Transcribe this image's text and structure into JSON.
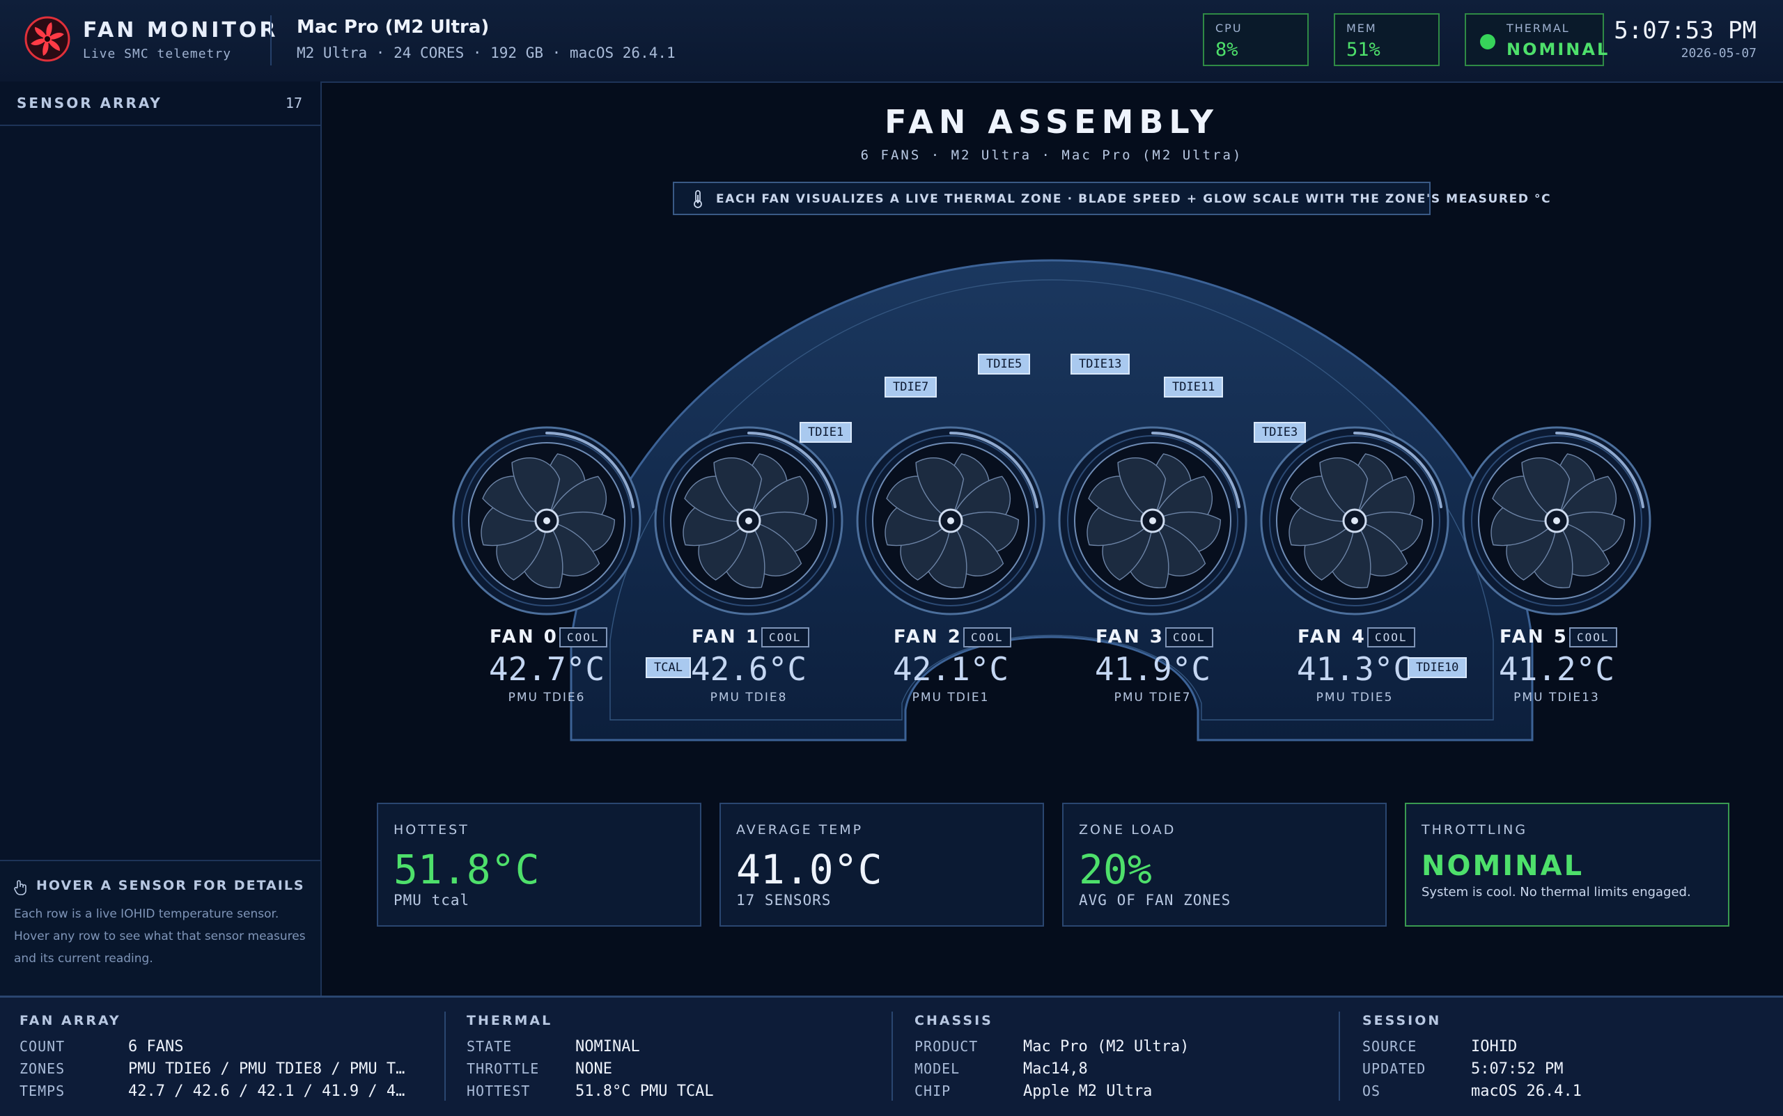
{
  "app": {
    "title": "FAN MONITOR",
    "subtitle": "Live SMC telemetry"
  },
  "machine": {
    "name": "Mac Pro (M2 Ultra)",
    "meta": "M2 Ultra · 24 CORES · 192 GB · macOS 26.4.1"
  },
  "stats": {
    "cpu": {
      "label": "CPU",
      "value": "8%"
    },
    "mem": {
      "label": "MEM",
      "value": "51%"
    },
    "thermal": {
      "label": "THERMAL",
      "value": "NOMINAL"
    }
  },
  "clock": {
    "time": "5:07:53 PM",
    "date": "2026-05-07"
  },
  "sidebar": {
    "title": "SENSOR ARRAY",
    "count": "17",
    "hint_title": "HOVER A SENSOR FOR DETAILS",
    "hint_body": "Each row is a live IOHID temperature sensor. Hover any row to see what that sensor measures and its current reading."
  },
  "main": {
    "title": "FAN ASSEMBLY",
    "subtitle": "6 FANS  ·  M2 Ultra  ·  Mac Pro (M2 Ultra)",
    "banner": "EACH FAN VISUALIZES A LIVE THERMAL ZONE · BLADE SPEED + GLOW SCALE WITH THE ZONE'S MEASURED °C"
  },
  "fans": [
    {
      "name": "FAN 0",
      "badge": "COOL",
      "temp": "42.7°C",
      "zone": "PMU TDIE6"
    },
    {
      "name": "FAN 1",
      "badge": "COOL",
      "temp": "42.6°C",
      "zone": "PMU TDIE8"
    },
    {
      "name": "FAN 2",
      "badge": "COOL",
      "temp": "42.1°C",
      "zone": "PMU TDIE1"
    },
    {
      "name": "FAN 3",
      "badge": "COOL",
      "temp": "41.9°C",
      "zone": "PMU TDIE7"
    },
    {
      "name": "FAN 4",
      "badge": "COOL",
      "temp": "41.3°C",
      "zone": "PMU TDIE5"
    },
    {
      "name": "FAN 5",
      "badge": "COOL",
      "temp": "41.2°C",
      "zone": "PMU TDIE13"
    }
  ],
  "chips": [
    "TDIE5",
    "TDIE13",
    "TDIE7",
    "TDIE11",
    "TDIE1",
    "TDIE3",
    "TCAL",
    "TDIE10"
  ],
  "cards": {
    "hottest": {
      "title": "HOTTEST",
      "value": "51.8°C",
      "sub": "PMU tcal"
    },
    "average": {
      "title": "AVERAGE TEMP",
      "value": "41.0°C",
      "sub": "17 SENSORS"
    },
    "load": {
      "title": "ZONE LOAD",
      "value": "20%",
      "sub": "AVG OF FAN ZONES"
    },
    "throttle": {
      "title": "THROTTLING",
      "value": "NOMINAL",
      "sub": "System is cool. No thermal limits engaged."
    }
  },
  "footer": {
    "fan_array": {
      "title": "FAN ARRAY",
      "rows": [
        {
          "k": "COUNT",
          "v": "6 FANS"
        },
        {
          "k": "ZONES",
          "v": "PMU TDIE6 / PMU TDIE8 / PMU T…"
        },
        {
          "k": "TEMPS",
          "v": "42.7 / 42.6 / 42.1 / 41.9 / 4…"
        }
      ]
    },
    "thermal": {
      "title": "THERMAL",
      "rows": [
        {
          "k": "STATE",
          "v": "NOMINAL"
        },
        {
          "k": "THROTTLE",
          "v": "NONE"
        },
        {
          "k": "HOTTEST",
          "v": "51.8°C PMU TCAL"
        }
      ]
    },
    "chassis": {
      "title": "CHASSIS",
      "rows": [
        {
          "k": "PRODUCT",
          "v": "Mac Pro (M2 Ultra)"
        },
        {
          "k": "MODEL",
          "v": "Mac14,8"
        },
        {
          "k": "CHIP",
          "v": "Apple M2 Ultra"
        }
      ]
    },
    "session": {
      "title": "SESSION",
      "rows": [
        {
          "k": "SOURCE",
          "v": "IOHID"
        },
        {
          "k": "UPDATED",
          "v": "5:07:52 PM"
        },
        {
          "k": "OS",
          "v": "macOS 26.4.1"
        }
      ]
    }
  },
  "colors": {
    "accent": "#4ee06b",
    "background": "#050d1c",
    "panel": "#0b1a33",
    "logo": "#e0303a"
  }
}
